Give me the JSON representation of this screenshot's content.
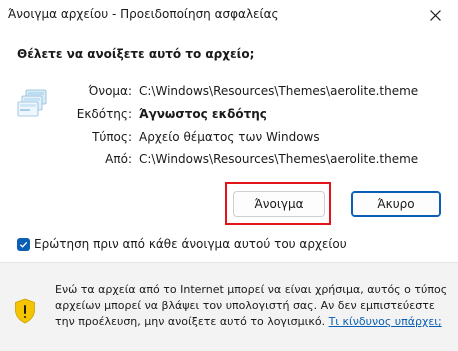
{
  "window": {
    "title": "Άνοιγμα αρχείου - Προειδοποίηση ασφαλείας"
  },
  "dialog": {
    "question": "Θέλετε να ανοίξετε αυτό το αρχείο;",
    "fields": [
      {
        "label": "Όνομα:",
        "value": "C:\\Windows\\Resources\\Themes\\aerolite.theme"
      },
      {
        "label": "Εκδότης:",
        "value": "Άγνωστος εκδότης"
      },
      {
        "label": "Τύπος:",
        "value": "Αρχείο θέματος των Windows"
      },
      {
        "label": "Από:",
        "value": "C:\\Windows\\Resources\\Themes\\aerolite.theme"
      }
    ],
    "open_label": "Άνοιγμα",
    "cancel_label": "Άκυρο",
    "checkbox_label": "Ερώτηση πριν από κάθε άνοιγμα αυτού του αρχείου",
    "checkbox_checked": true
  },
  "footer": {
    "warning_text": "Ενώ τα αρχεία από το Internet μπορεί να είναι χρήσιμα, αυτός ο τύπος αρχείων μπορεί να βλάψει τον υπολογιστή σας. Αν δεν εμπιστεύεστε την προέλευση, μην ανοίξετε αυτό το λογισμικό.",
    "link_text": "Τι κίνδυνος υπάρχει;"
  },
  "colors": {
    "accent": "#0a5fb4",
    "highlight": "#e3141a",
    "shield": "#f5c400"
  },
  "icons": {
    "close": "close-icon",
    "file": "theme-file-icon",
    "shield": "shield-warning-icon",
    "check": "checkmark-icon"
  }
}
